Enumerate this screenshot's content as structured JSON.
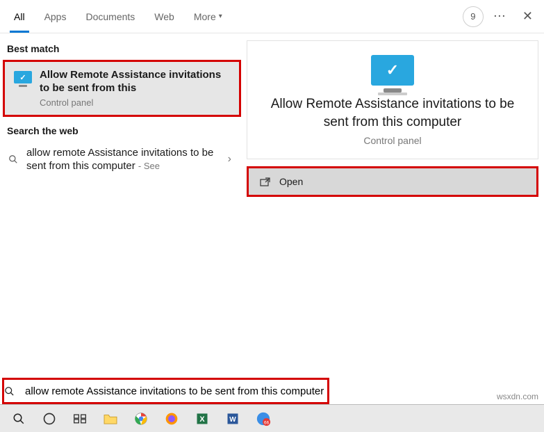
{
  "tabs": {
    "all": "All",
    "apps": "Apps",
    "documents": "Documents",
    "web": "Web",
    "more": "More"
  },
  "top_right": {
    "counter": "9"
  },
  "sections": {
    "best_match": "Best match",
    "search_web": "Search the web"
  },
  "best_result": {
    "title": "Allow Remote Assistance invitations to be sent from this",
    "subtitle": "Control panel"
  },
  "web_result": {
    "text": "allow remote Assistance invitations to be sent from this computer",
    "suffix": "- See"
  },
  "preview": {
    "title": "Allow Remote Assistance invitations to be sent from this computer",
    "subtitle": "Control panel",
    "action": "Open"
  },
  "search": {
    "value": "allow remote Assistance invitations to be sent from this computer"
  },
  "watermark": "wsxdn.com"
}
